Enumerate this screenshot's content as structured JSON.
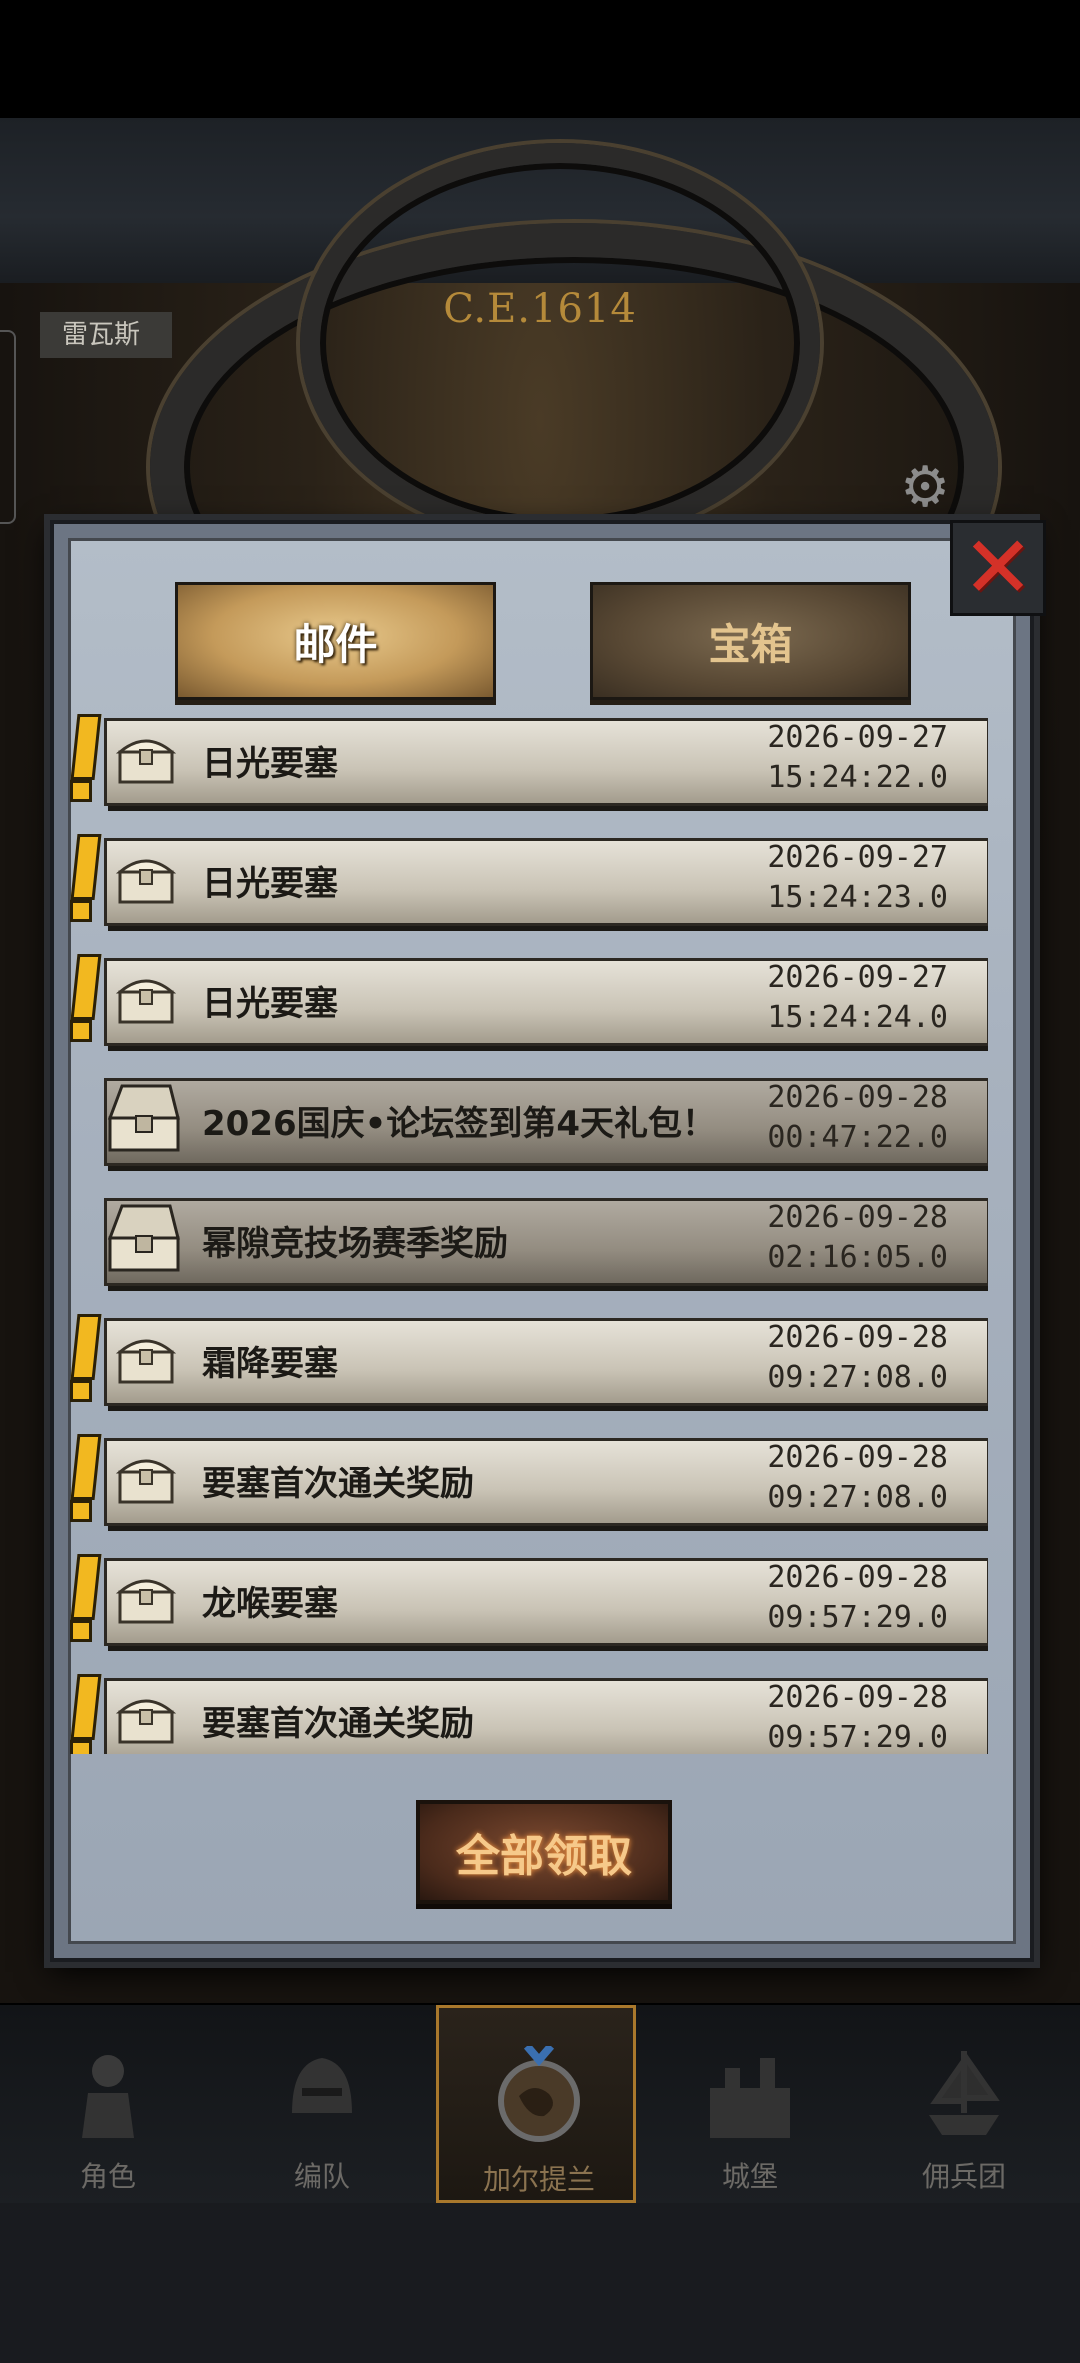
{
  "background": {
    "era_label": "C.E.1614",
    "location_label": "雷瓦斯"
  },
  "dialog": {
    "tabs": [
      {
        "label": "邮件",
        "active": true
      },
      {
        "label": "宝箱",
        "active": false
      }
    ],
    "close_icon": "close-x-icon",
    "mails": [
      {
        "title": "日光要塞",
        "date": "2026-09-27",
        "time": "15:24:22.0",
        "unread": true
      },
      {
        "title": "日光要塞",
        "date": "2026-09-27",
        "time": "15:24:23.0",
        "unread": true
      },
      {
        "title": "日光要塞",
        "date": "2026-09-27",
        "time": "15:24:24.0",
        "unread": true
      },
      {
        "title": "2026国庆•论坛签到第4天礼包！",
        "date": "2026-09-28",
        "time": "00:47:22.0",
        "unread": false
      },
      {
        "title": "幂隙竞技场赛季奖励",
        "date": "2026-09-28",
        "time": "02:16:05.0",
        "unread": false
      },
      {
        "title": "霜降要塞",
        "date": "2026-09-28",
        "time": "09:27:08.0",
        "unread": true
      },
      {
        "title": "要塞首次通关奖励",
        "date": "2026-09-28",
        "time": "09:27:08.0",
        "unread": true
      },
      {
        "title": "龙喉要塞",
        "date": "2026-09-28",
        "time": "09:57:29.0",
        "unread": true
      },
      {
        "title": "要塞首次通关奖励",
        "date": "2026-09-28",
        "time": "09:57:29.0",
        "unread": true
      }
    ],
    "claim_all_label": "全部领取"
  },
  "nav": [
    {
      "label": "角色",
      "icon": "knight-icon",
      "selected": false
    },
    {
      "label": "编队",
      "icon": "helmet-icon",
      "selected": false
    },
    {
      "label": "加尔提兰",
      "icon": "world-map-icon",
      "selected": true
    },
    {
      "label": "城堡",
      "icon": "castle-icon",
      "selected": false
    },
    {
      "label": "佣兵团",
      "icon": "ship-icon",
      "selected": false
    }
  ],
  "colors": {
    "accent_gold": "#e3c48e",
    "unread_marker": "#f2b820",
    "close_red": "#d43128"
  }
}
